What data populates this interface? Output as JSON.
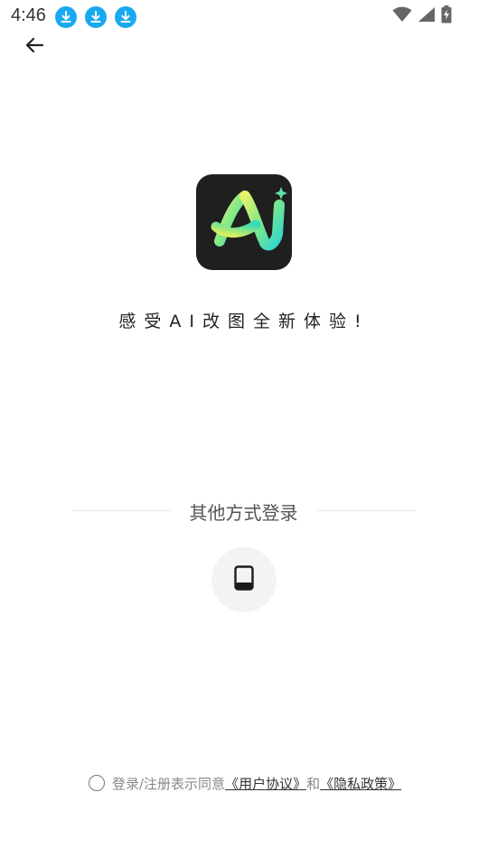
{
  "status_bar": {
    "time": "4:46",
    "notification_icons": [
      "download-icon",
      "download-icon",
      "download-icon"
    ],
    "system_icons": [
      "wifi-icon",
      "signal-icon",
      "battery-charging-icon"
    ],
    "accent_color": "#19a9f0"
  },
  "header": {
    "back_icon": "arrow-left-icon"
  },
  "brand": {
    "logo_icon": "ai-app-logo",
    "logo_background": "#1f1f1f",
    "slogan": "感受AI改图全新体验!"
  },
  "other_login": {
    "label": "其他方式登录",
    "phone_icon": "phone-icon"
  },
  "agreement": {
    "prefix": "登录/注册表示同意",
    "user_agreement": "《用户协议》",
    "conjunction": "和",
    "privacy_policy": "《隐私政策》",
    "checked": false
  }
}
